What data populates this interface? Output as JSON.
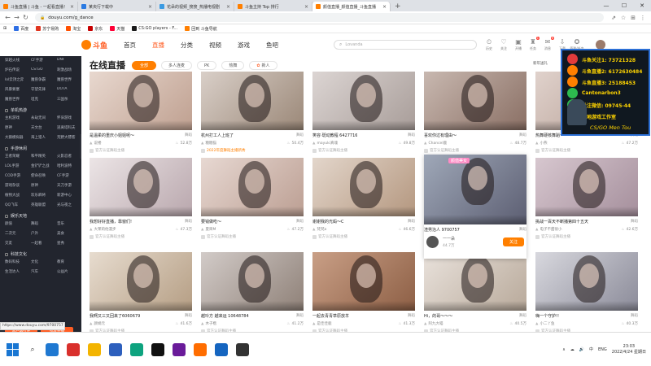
{
  "browser": {
    "tabs": [
      {
        "title": "斗鱼直播 | 斗鱼 - 一起看直播！",
        "color": "#ff7f00"
      },
      {
        "title": "某央行下载中"
      },
      {
        "title": "花朵的视频_搜搜_热播电视剧"
      },
      {
        "title": "斗鱼主持 Top 排行"
      },
      {
        "title": "颜值直播_颜值直播_斗鱼直播"
      }
    ],
    "new_tab": "+",
    "window_controls": [
      "—",
      "☐",
      "✕"
    ],
    "url": "douyu.com/g_dance",
    "bookmarks": [
      "百度",
      "苏宁易购",
      "淘宝",
      "京东",
      "天猫",
      "CS:GO players - F...",
      "回到 斗鱼导航"
    ]
  },
  "site": {
    "logo": "斗鱼",
    "nav": [
      "首页",
      "直播",
      "分类",
      "视频",
      "游戏",
      "鱼吧"
    ],
    "nav_active": 1,
    "search_placeholder": "Lovanda",
    "user_icons": [
      {
        "label": "历史",
        "glyph": "⏲"
      },
      {
        "label": "关注",
        "glyph": "♡"
      },
      {
        "label": "开播",
        "glyph": "▣"
      },
      {
        "label": "任务",
        "glyph": "♜",
        "badge": "1"
      },
      {
        "label": "消息",
        "glyph": "✉",
        "badge": "6"
      },
      {
        "label": "下载",
        "glyph": "⇩"
      },
      {
        "label": "签到/任务",
        "glyph": "✪"
      }
    ]
  },
  "sidebar": {
    "sections": [
      {
        "title": "",
        "items": [
          "穿越火线",
          "CF手游",
          "DNF",
          "炉石传说",
          "CS:GO",
          "刺激战场",
          "lol云顶之弈",
          "魔兽争霸",
          "魔兽世界",
          "风暴要塞",
          "守望先锋",
          "DOTA",
          "魔兽世界",
          "坦克",
          "三国杀"
        ]
      },
      {
        "title": "单机热游",
        "items": [
          "主机游戏",
          "永劫无间",
          "怀旧游戏",
          "原神",
          "天文台",
          "逃离塔科夫",
          "大鹅模拟器",
          "海上猎人",
          "荒野大镖客"
        ]
      },
      {
        "title": "手游休闲",
        "items": [
          "王者荣耀",
          "和平精英",
          "火影忍者",
          "LOL手游",
          "金铲铲之战",
          "哈利波特",
          "COD手游",
          "使命召唤",
          "CF手游",
          "游戏杂谈",
          "原神",
          "天刀手游",
          "植物大战",
          "欢乐麻将",
          "新游中心",
          "QQ飞车",
          "英雄联盟",
          "光与夜之"
        ]
      },
      {
        "title": "娱乐天地",
        "items": [
          "颜值",
          "舞蹈",
          "音乐",
          "二次元",
          "户外",
          "美食",
          "交友",
          "一起看",
          "星秀"
        ]
      },
      {
        "title": "科技文化",
        "items": [
          "数码科技",
          "文化",
          "教育",
          "生活达人",
          "汽车",
          "公益片"
        ]
      }
    ],
    "buttons": [
      "客户端打开",
      "找客开播"
    ],
    "toggle": "‹"
  },
  "main": {
    "page_title": "在线直播",
    "filters": [
      "全部",
      "多人连麦",
      "PK",
      "热舞",
      "新人"
    ],
    "filter_active": 0,
    "top_badge": "新年送礼",
    "cards": [
      {
        "title": "是温柔的重庆小姐姐呢～",
        "cat": "舞蹈",
        "streamer": "说楼",
        "views": "52.8万",
        "tag": "官方认证舞蹈主播"
      },
      {
        "title": "杭州打工人上班了",
        "cat": "舞蹈",
        "streamer": "糖糖猫",
        "views": "50.4万",
        "tag": "2022年度舞蹈主播新秀",
        "tag_orange": true
      },
      {
        "title": "笑容·斑动教程 6427716",
        "cat": "舞蹈",
        "streamer": "mayuki真魂",
        "views": "49.8万",
        "tag": "官方认证舞蹈主播"
      },
      {
        "title": "喜欢你过有理由～",
        "cat": "舞蹈",
        "streamer": "Chancel鹿",
        "views": "48.7万",
        "tag": "官方认证舞蹈主播"
      },
      {
        "title": "热舞硬核舞蹈一",
        "cat": "舞蹈",
        "streamer": "小燕",
        "views": "47.2万",
        "tag": "官方认证舞蹈主播"
      },
      {
        "title": "我想好好直播，靠窗们!",
        "cat": "舞蹈",
        "streamer": "大茉莉他漫步",
        "views": "47.3万",
        "tag": "官方认证舞蹈主播"
      },
      {
        "title": "要钱做吃～",
        "cat": "舞蹈",
        "streamer": "夏目M",
        "views": "47.2万",
        "tag": "官方认证舞蹈主播"
      },
      {
        "title": "谢谢我的光蚂～C",
        "cat": "舞蹈",
        "streamer": "梵梵a",
        "views": "46.6万",
        "tag": "官方认证舞蹈主播"
      },
      {
        "title": "渣男治人 9700757",
        "cat": "舞蹈",
        "streamer": "一一朵",
        "views": "44.7万",
        "hover": true,
        "follow": "关注",
        "thumb_label": "颜值美女"
      },
      {
        "title": "挑战一百天不断播第四十五天",
        "cat": "舞蹈",
        "streamer": "电子不甜很小",
        "views": "42.6万",
        "tag": "官方认证舞蹈主播"
      },
      {
        "title": "我啊又三又回来了6060679",
        "cat": "舞蹈",
        "streamer": "颜娟元",
        "views": "41.6万",
        "tag": "官方认证舞蹈主播"
      },
      {
        "title": "越玲方 越来运 10648784",
        "cat": "舞蹈",
        "streamer": "木子楷",
        "views": "41.2万",
        "tag": "官方认证舞蹈主播"
      },
      {
        "title": "一起去青青草原放羊",
        "cat": "舞蹈",
        "streamer": "是佳佳鹿",
        "views": "41.3万",
        "tag": "官方认证舞蹈主播"
      },
      {
        "title": "Hi，的哥～～～",
        "cat": "舞蹈",
        "streamer": "阿九大喵",
        "views": "40.5万",
        "tag": "官方认证舞蹈主播"
      },
      {
        "title": "嗨一个守护!!",
        "cat": "舞蹈",
        "streamer": "小二丫鱼",
        "views": "40.3万",
        "tag": "官方认证舞蹈主播"
      }
    ]
  },
  "overlay": {
    "lines": [
      "斗鱼关注1: 73721328",
      "斗鱼直播2: 6172630484",
      "斗鱼直播3: 25188453",
      "Cantonarbon3",
      "关注微信: 09745-44",
      "天地游戏工作室"
    ],
    "footer": "CS/GO Men Tou"
  },
  "status_url": "https://www.douyu.com/9700757",
  "taskbar": {
    "apps": [
      "#1f78d1",
      "#d9302c",
      "#f3b400",
      "#2d5fbd",
      "#0ea37f",
      "#111111",
      "#6a1b9a",
      "#ff6d00",
      "#1565c0",
      "#333333"
    ],
    "tray": [
      "∧",
      "☁",
      "🔊",
      "中",
      "ENG"
    ],
    "time": "23:03",
    "date": "2022/4/24 星期日"
  },
  "colors": {
    "brand": "#ff5d23",
    "accent": "#ff7f00",
    "sidebar": "#22252e"
  }
}
